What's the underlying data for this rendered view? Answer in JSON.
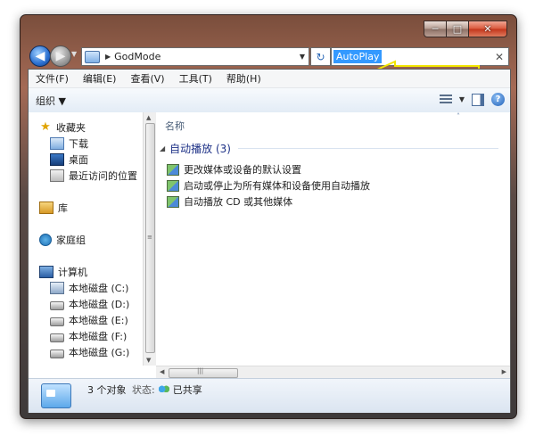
{
  "window": {
    "caption": {
      "minimize": "─",
      "maximize": "□",
      "close": "✕"
    }
  },
  "nav": {
    "back_glyph": "◀",
    "forward_glyph": "▶",
    "breadcrumb_sep": "▶",
    "breadcrumb": "GodMode",
    "addr_drop": "▼",
    "refresh_glyph": "↻",
    "search_value": "AutoPlay",
    "clear_glyph": "✕"
  },
  "menu": [
    "文件(F)",
    "编辑(E)",
    "查看(V)",
    "工具(T)",
    "帮助(H)"
  ],
  "toolbar": {
    "organize": "组织 ▼",
    "view_drop": "▼",
    "help": "?"
  },
  "sidebar": {
    "favorites": "收藏夹",
    "downloads": "下载",
    "desktop": "桌面",
    "recent": "最近访问的位置",
    "libraries": "库",
    "homegroup": "家庭组",
    "computer": "计算机",
    "drives": [
      "本地磁盘 (C:)",
      "本地磁盘 (D:)",
      "本地磁盘 (E:)",
      "本地磁盘 (F:)",
      "本地磁盘 (G:)"
    ]
  },
  "main": {
    "column_name": "名称",
    "group_title": "自动播放 (3)",
    "items": [
      "更改媒体或设备的默认设置",
      "启动或停止为所有媒体和设备使用自动播放",
      "自动播放 CD 或其他媒体"
    ]
  },
  "status": {
    "count": "3 个对象",
    "state_label": "状态:",
    "shared": "已共享"
  },
  "colors": {
    "selection": "#3399ff",
    "group_title": "#1e3287",
    "annotation_arrow": "#f2e600"
  },
  "icons": {
    "back": "back-arrow-icon",
    "forward": "forward-arrow-icon",
    "refresh": "refresh-icon",
    "help": "help-icon",
    "favorites": "star-icon",
    "control_panel": "control-panel-icon",
    "share": "share-icon"
  }
}
